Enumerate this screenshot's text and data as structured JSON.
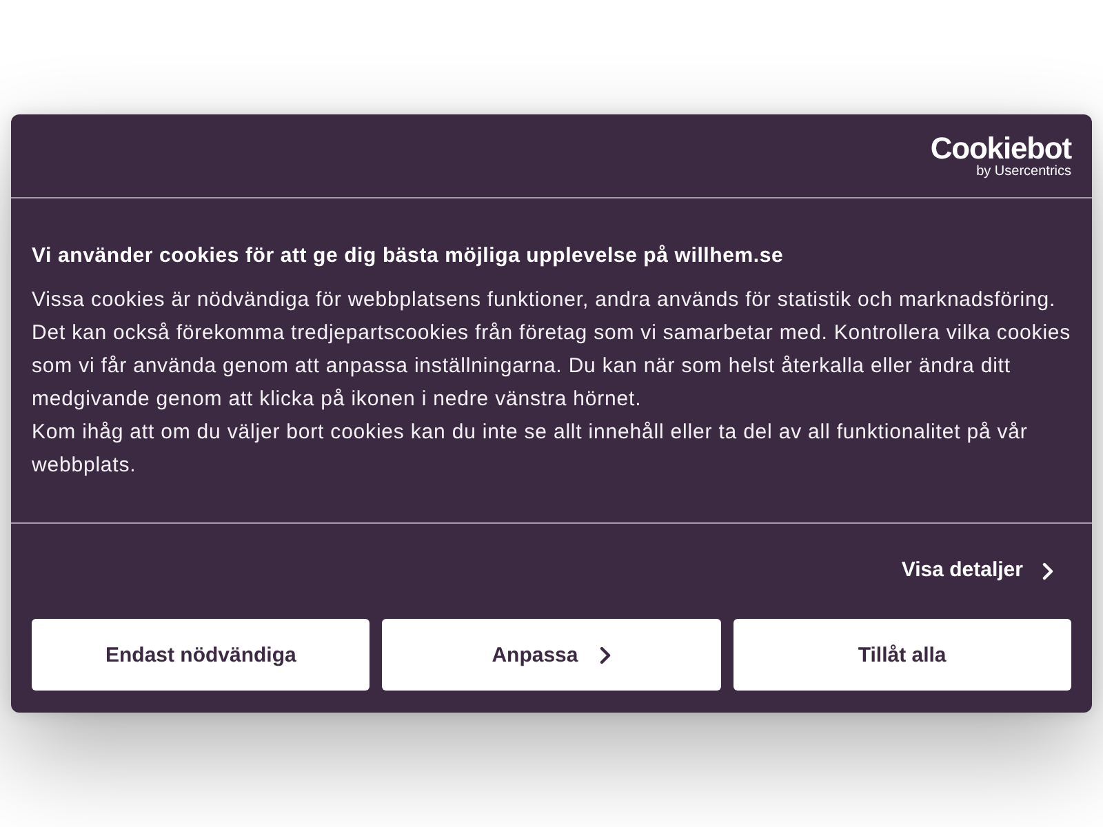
{
  "banner": {
    "logo": {
      "wordmark": "Cookiebot",
      "byline": "by Usercentrics"
    },
    "heading": "Vi använder cookies för att ge dig bästa möjliga upplevelse på willhem.se",
    "paragraphs": [
      "Vissa cookies är nödvändiga för webbplatsens funktioner, andra används för statistik och marknadsföring. Det kan också förekomma tredjepartscookies från företag som vi samarbetar med. Kontrollera vilka cookies som vi får använda genom att anpassa inställningarna. Du kan när som helst återkalla eller ändra ditt medgivande genom att klicka på ikonen i nedre vänstra hörnet.",
      "Kom ihåg att om du väljer bort cookies kan du inte se allt innehåll eller ta del av all funktionalitet på vår webbplats."
    ],
    "details_link": "Visa detaljer",
    "buttons": [
      {
        "label": "Endast nödvändiga",
        "chevron": false
      },
      {
        "label": "Anpassa",
        "chevron": true
      },
      {
        "label": "Tillåt alla",
        "chevron": false
      }
    ]
  }
}
